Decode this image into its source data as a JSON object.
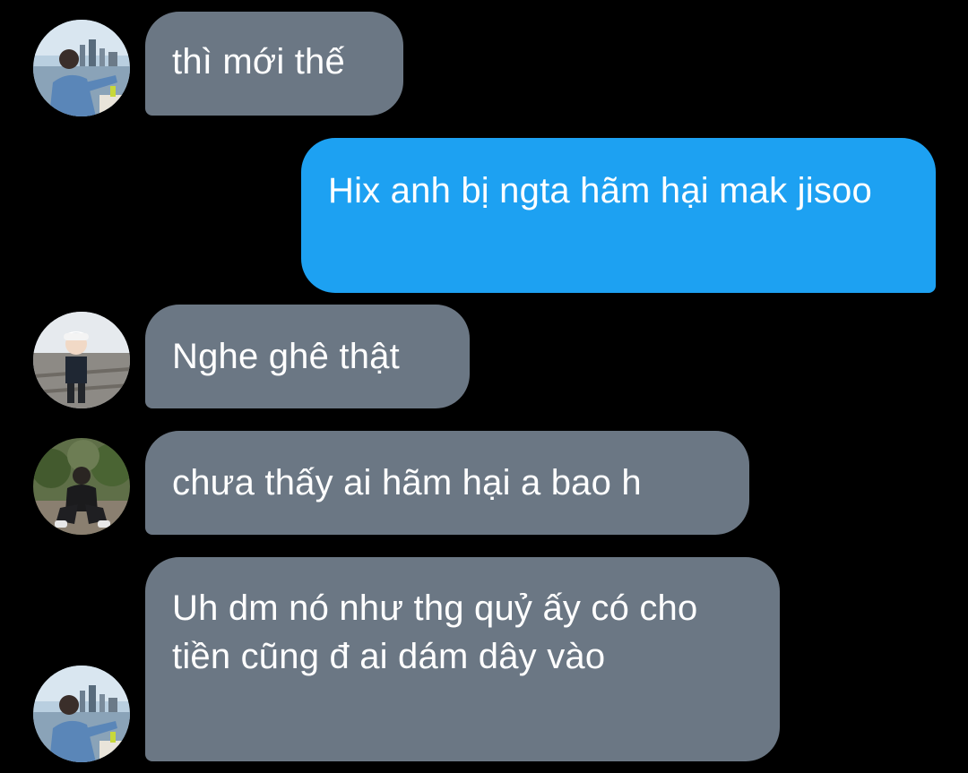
{
  "conversation": {
    "messages": [
      {
        "direction": "incoming",
        "text": "thì mới thế",
        "avatar": "avatar-user-a"
      },
      {
        "direction": "outgoing",
        "text": "Hix anh bị ngta hãm hại mak jisoo"
      },
      {
        "direction": "incoming",
        "text": "Nghe ghê thật",
        "avatar": "avatar-user-b"
      },
      {
        "direction": "incoming",
        "text": "chưa thấy ai hãm hại a bao h",
        "avatar": "avatar-user-c"
      },
      {
        "direction": "incoming",
        "text": "Uh dm nó như thg quỷ ấy có cho tiền cũng đ ai dám dây vào",
        "avatar": "avatar-user-a"
      }
    ]
  },
  "colors": {
    "background": "#000000",
    "incoming_bubble": "#6b7784",
    "outgoing_bubble": "#1da1f2",
    "text": "#ffffff"
  }
}
